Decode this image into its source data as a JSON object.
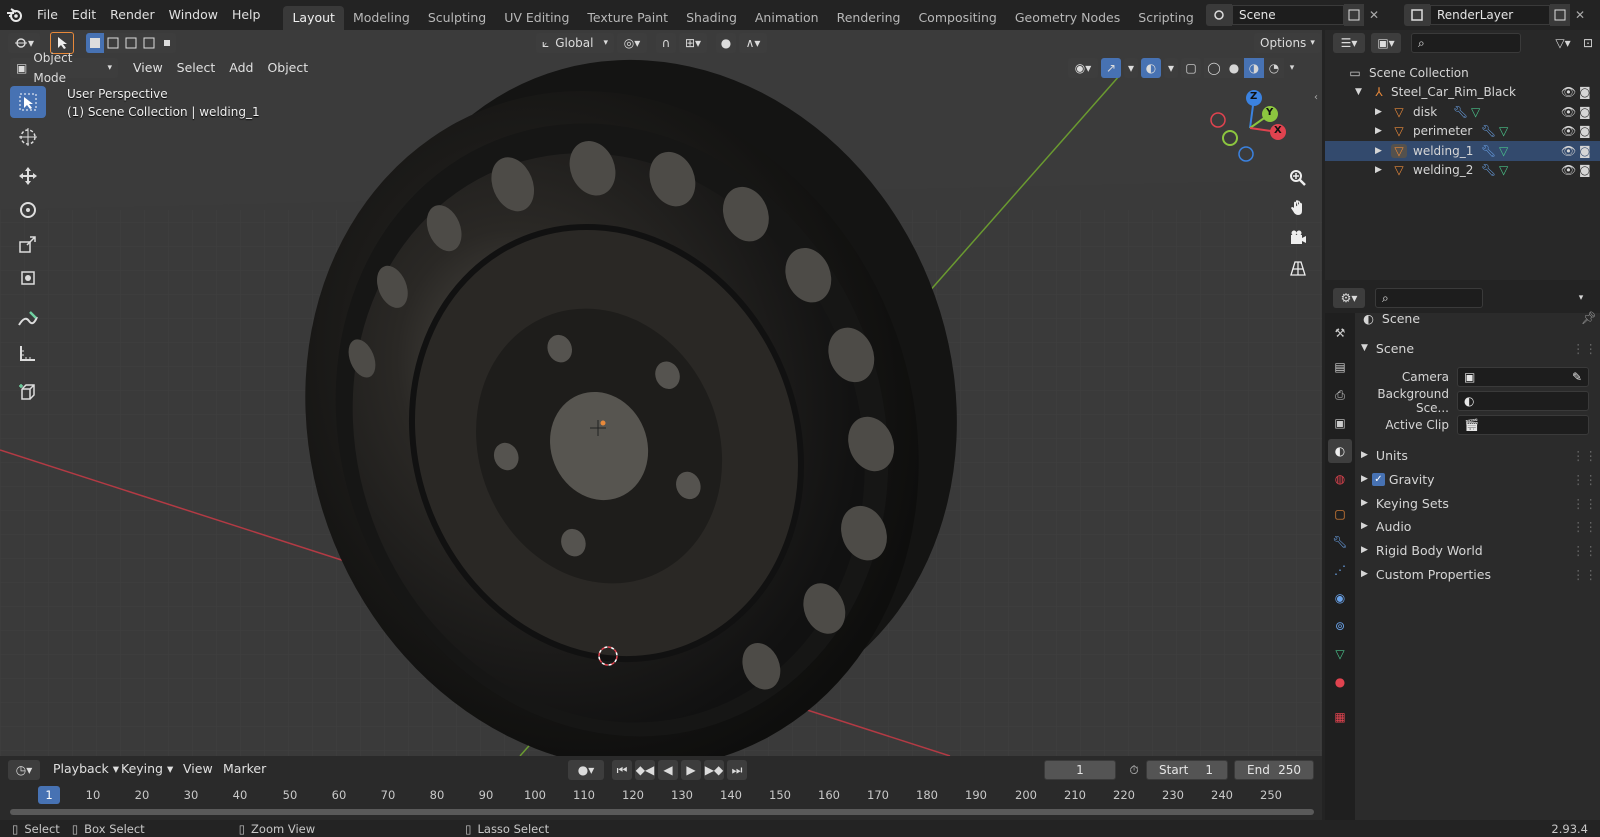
{
  "top_menu": {
    "items": [
      "File",
      "Edit",
      "Render",
      "Window",
      "Help"
    ]
  },
  "workspaces": {
    "tabs": [
      "Layout",
      "Modeling",
      "Sculpting",
      "UV Editing",
      "Texture Paint",
      "Shading",
      "Animation",
      "Rendering",
      "Compositing",
      "Geometry Nodes",
      "Scripting"
    ],
    "active": "Layout"
  },
  "scene_selector": {
    "value": "Scene"
  },
  "view_layer": {
    "value": "RenderLayer"
  },
  "viewport": {
    "mode": "Object Mode",
    "menus": [
      "View",
      "Select",
      "Add",
      "Object"
    ],
    "transform_orientation": "Global",
    "options_label": "Options",
    "overlay_title": "User Perspective",
    "overlay_subtitle": "(1) Scene Collection | welding_1",
    "gizmo_axes": {
      "z": "Z",
      "y": "Y",
      "x": "X"
    }
  },
  "outliner": {
    "root": "Scene Collection",
    "collection": "Steel_Car_Rim_Black",
    "objects": [
      "disk",
      "perimeter",
      "welding_1",
      "welding_2"
    ],
    "selected": "welding_1"
  },
  "properties": {
    "context": "Scene",
    "section": "Scene",
    "fields": [
      {
        "label": "Camera",
        "value": ""
      },
      {
        "label": "Background Sce...",
        "value": ""
      },
      {
        "label": "Active Clip",
        "value": ""
      }
    ],
    "panels": [
      "Units",
      "Gravity",
      "Keying Sets",
      "Audio",
      "Rigid Body World",
      "Custom Properties"
    ],
    "gravity_checked": true
  },
  "timeline": {
    "menus": [
      "Playback",
      "Keying",
      "View",
      "Marker"
    ],
    "current_frame": "1",
    "start_label": "Start",
    "start": "1",
    "end_label": "End",
    "end": "250",
    "ruler": [
      "1",
      "10",
      "20",
      "30",
      "40",
      "50",
      "60",
      "70",
      "80",
      "90",
      "100",
      "110",
      "120",
      "130",
      "140",
      "150",
      "160",
      "170",
      "180",
      "190",
      "200",
      "210",
      "220",
      "230",
      "240",
      "250"
    ]
  },
  "statusbar": {
    "items": [
      "Select",
      "Box Select",
      "Zoom View",
      "Lasso Select"
    ],
    "version": "2.93.4"
  },
  "colors": {
    "accent": "#4772b3",
    "x_axis": "#e0434f",
    "y_axis": "#8cc63f",
    "z_axis": "#3b82e0",
    "object_orange": "#e8893a",
    "mesh_green": "#4ac18a"
  }
}
